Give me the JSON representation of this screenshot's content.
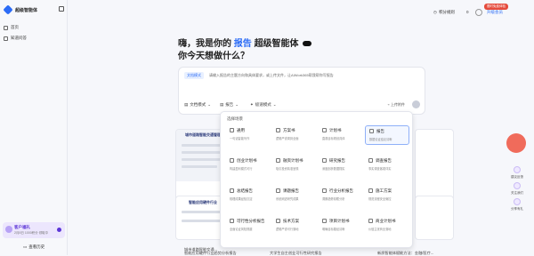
{
  "app": {
    "name": "超级智能体"
  },
  "sidebar": {
    "items": [
      {
        "label": "首页"
      },
      {
        "label": "知道问答"
      }
    ],
    "promo": {
      "title": "客户福礼",
      "subtitle": "2月8日 1000积分 领取中"
    },
    "history_label": "查看历史"
  },
  "topbar": {
    "credits_label": "积分规则",
    "free_badge": "限时免费体验",
    "upgrade_label": "升级会员",
    "credit_value": "0"
  },
  "hero": {
    "greet_prefix": "嗨，我是你的",
    "greet_highlight": "报告",
    "greet_suffix": "超级智能体",
    "question": "你今天想做什么？"
  },
  "input": {
    "tag": "文档模式",
    "placeholder": "请输入报告的主题方向和具体要求，或上传文件，让AIWork365帮我帮你写报告",
    "tools": [
      "文档模式",
      "报告",
      "极速模式"
    ],
    "upload_label": "上传附件"
  },
  "dropdown": {
    "title": "选择场景",
    "options": [
      {
        "name": "通用",
        "desc": "一句话智能写作"
      },
      {
        "name": "方案书",
        "desc": "逻辑严谨周到全面"
      },
      {
        "name": "计划书",
        "desc": "直观目标规划具体"
      },
      {
        "name": "报告",
        "desc": "数据论证结论清晰"
      },
      {
        "name": "创业计划书",
        "desc": "构建盈利模式可行"
      },
      {
        "name": "融资计划书",
        "desc": "吸引投资精准呈现"
      },
      {
        "name": "研究报告",
        "desc": "深度剖析数据翔实"
      },
      {
        "name": "调查报告",
        "desc": "事实调查客观详实"
      },
      {
        "name": "总结报告",
        "desc": "梳理成果经验沉淀"
      },
      {
        "name": "课题报告",
        "desc": "系统阐述研究成果"
      },
      {
        "name": "行业分析报告",
        "desc": "洞察趋势前瞻分析"
      },
      {
        "name": "施工方案",
        "desc": "规范流程安全管控"
      },
      {
        "name": "可行性分析报告",
        "desc": "全面论证风险规避"
      },
      {
        "name": "技术方案",
        "desc": "逻辑严谨可行落地"
      },
      {
        "name": "项目计划书",
        "desc": "明确目标路径清晰"
      },
      {
        "name": "商业计划书",
        "desc": "价值主张商业落地"
      }
    ]
  },
  "cards": [
    {
      "caption": "城市道路智能交通..."
    },
    {
      "caption": "智能应用硬件行业趋势分析报告"
    },
    {
      "caption": "大学生自主创业可行性研究报告"
    },
    {
      "caption": "新质智能体赋能方法：金融/医疗..."
    }
  ],
  "card_heading": "城市道路智能交通管理",
  "card2_heading": "智能应用硬件行业",
  "rail": [
    {
      "label": "建议反馈"
    },
    {
      "label": "关注我们"
    },
    {
      "label": "分享有礼"
    }
  ]
}
